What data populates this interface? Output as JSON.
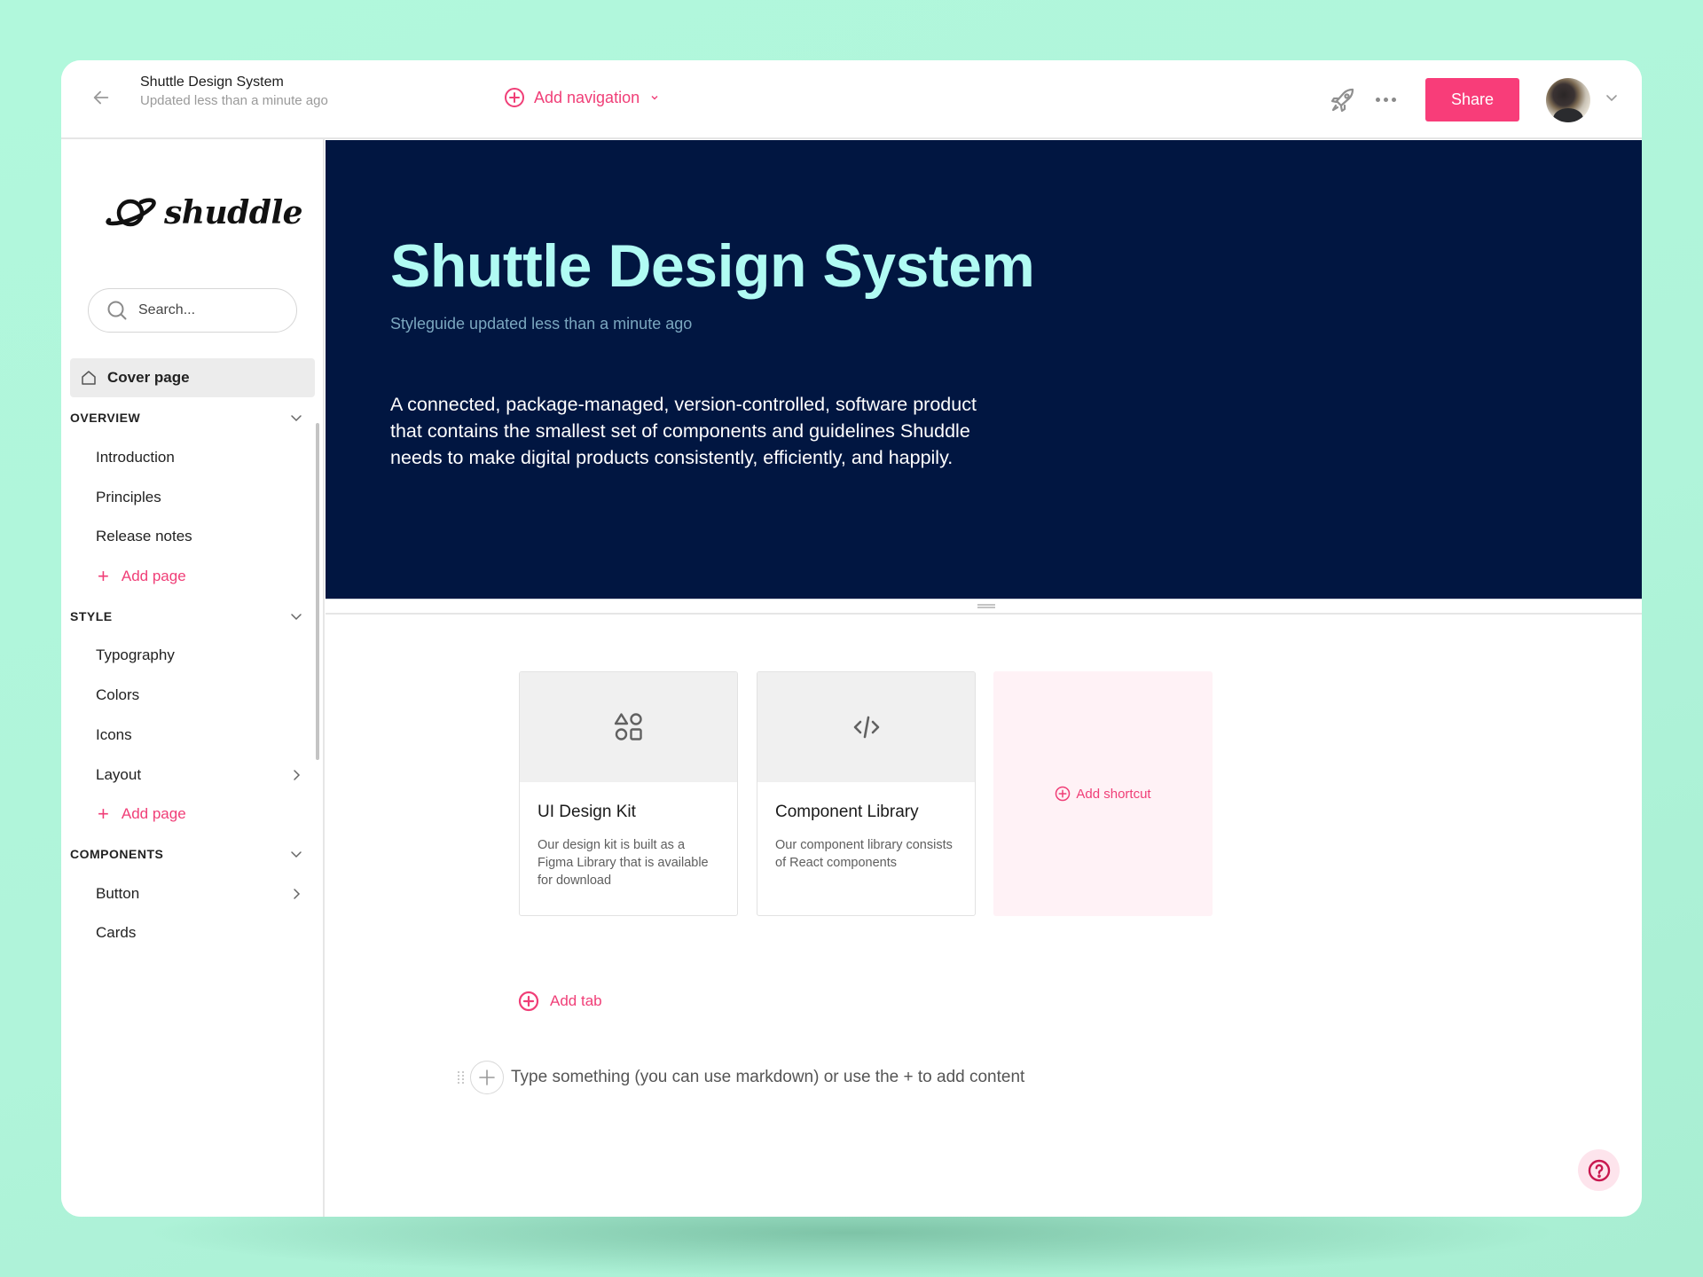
{
  "header": {
    "title": "Shuttle Design System",
    "subtitle": "Updated less than a minute ago",
    "add_navigation_label": "Add navigation",
    "share_label": "Share",
    "icons": {
      "back": "arrow-left-icon",
      "add_nav": "plus-circle-icon",
      "rocket": "rocket-icon",
      "more": "more-horizontal-icon",
      "avatar_caret": "chevron-down-icon"
    }
  },
  "sidebar": {
    "logo_text": "shuddle",
    "search_placeholder": "Search...",
    "cover_page": "Cover page",
    "sections": [
      {
        "title": "OVERVIEW",
        "expanded": true,
        "items": [
          {
            "label": "Introduction",
            "has_children": false
          },
          {
            "label": "Principles",
            "has_children": false
          },
          {
            "label": "Release notes",
            "has_children": false
          }
        ],
        "add_label": "Add page"
      },
      {
        "title": "STYLE",
        "expanded": true,
        "items": [
          {
            "label": "Typography",
            "has_children": false
          },
          {
            "label": "Colors",
            "has_children": false
          },
          {
            "label": "Icons",
            "has_children": false
          },
          {
            "label": "Layout",
            "has_children": true
          }
        ],
        "add_label": "Add page"
      },
      {
        "title": "COMPONENTS",
        "expanded": true,
        "items": [
          {
            "label": "Button",
            "has_children": true
          },
          {
            "label": "Cards",
            "has_children": false
          }
        ]
      }
    ]
  },
  "hero": {
    "title": "Shuttle Design System",
    "subtitle": "Styleguide updated less than a minute ago",
    "description": "A connected, package-managed, version-controlled, software product that contains the smallest set of components and guidelines Shuddle needs to make digital products consistently, efficiently, and happily."
  },
  "shortcuts": [
    {
      "icon": "shapes-icon",
      "title": "UI Design Kit",
      "description": "Our design kit is built as a Figma Library that is available for download"
    },
    {
      "icon": "code-icon",
      "title": "Component Library",
      "description": "Our component library consists of React components"
    }
  ],
  "add_shortcut_label": "Add shortcut",
  "add_tab_label": "Add tab",
  "editor": {
    "placeholder": "Type something (you can use markdown) or use the + to add content",
    "value": ""
  },
  "colors": {
    "accent": "#f83d79",
    "hero_bg": "#011641",
    "hero_title": "#b0fbf3",
    "background": "#b1f8dc"
  }
}
